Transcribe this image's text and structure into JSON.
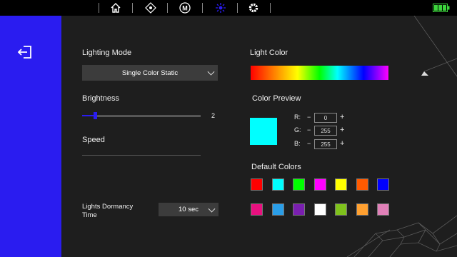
{
  "nav": {
    "items": [
      {
        "name": "home-icon"
      },
      {
        "name": "move-icon"
      },
      {
        "name": "macro-icon",
        "text": "M"
      },
      {
        "name": "lighting-icon"
      },
      {
        "name": "gear-icon"
      }
    ],
    "battery_color": "#3dd63d"
  },
  "colors": {
    "accent": "#2a1cf0",
    "panel": "#1e1e1e",
    "select_bg": "#3c3c3c"
  },
  "lighting_mode": {
    "label": "Lighting Mode",
    "value": "Single Color Static"
  },
  "brightness": {
    "label": "Brightness",
    "value": "2",
    "level_fraction": 0.11
  },
  "speed": {
    "label": "Speed"
  },
  "dormancy": {
    "label_line1": "Lights Dormancy",
    "label_line2": "Time",
    "value": "10 sec"
  },
  "light_color": {
    "label": "Light Color"
  },
  "color_preview": {
    "label": "Color Preview",
    "color": "#00ffff",
    "r": {
      "letter": "R:",
      "minus": "−",
      "value": "0",
      "plus": "+"
    },
    "g": {
      "letter": "G:",
      "minus": "−",
      "value": "255",
      "plus": "+"
    },
    "b": {
      "letter": "B:",
      "minus": "−",
      "value": "255",
      "plus": "+"
    }
  },
  "default_colors": {
    "label": "Default Colors",
    "row1": [
      "#ff0000",
      "#00ffff",
      "#00ff00",
      "#ff00ff",
      "#ffff00",
      "#ff5a00",
      "#0000ff"
    ],
    "row2": [
      "#e8107f",
      "#2a9ee8",
      "#7a1fb0",
      "#ffffff",
      "#7fc21c",
      "#ffa030",
      "#e080b8"
    ]
  }
}
